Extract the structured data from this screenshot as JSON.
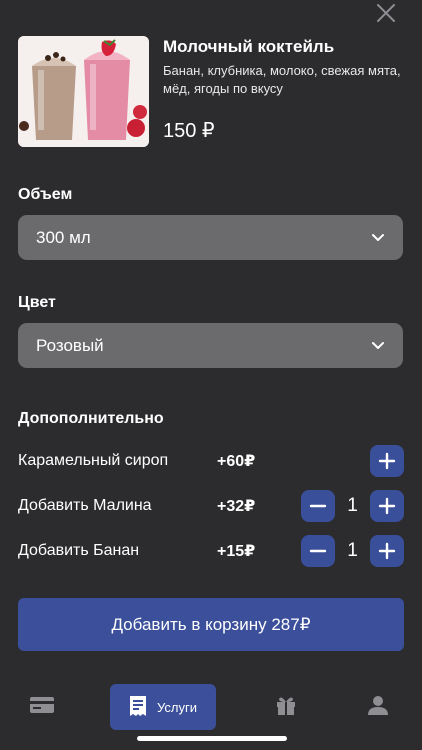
{
  "product": {
    "title": "Молочный коктейль",
    "description": "Банан, клубника, молоко, свежая мята, мёд, ягоды по вкусу",
    "price": "150 ₽",
    "image": "milkshake-photo"
  },
  "volume": {
    "label": "Объем",
    "selected": "300 мл"
  },
  "color": {
    "label": "Цвет",
    "selected": "Розовый"
  },
  "extras": {
    "label": "Допополнительно",
    "items": [
      {
        "name": "Карамельный сироп",
        "price": "+60₽",
        "qty": ""
      },
      {
        "name": "Добавить Малина",
        "price": "+32₽",
        "qty": "1"
      },
      {
        "name": "Добавить Банан",
        "price": "+15₽",
        "qty": "1"
      }
    ]
  },
  "cart_button": "Добавить в корзину 287₽",
  "nav": {
    "items": [
      {
        "icon": "card-icon",
        "label": ""
      },
      {
        "icon": "receipt-icon",
        "label": "Услуги"
      },
      {
        "icon": "gift-icon",
        "label": ""
      },
      {
        "icon": "user-icon",
        "label": ""
      }
    ]
  },
  "colors": {
    "background": "#2c2c2e",
    "accent": "#3b4f9b",
    "select": "#6b6b6d"
  }
}
